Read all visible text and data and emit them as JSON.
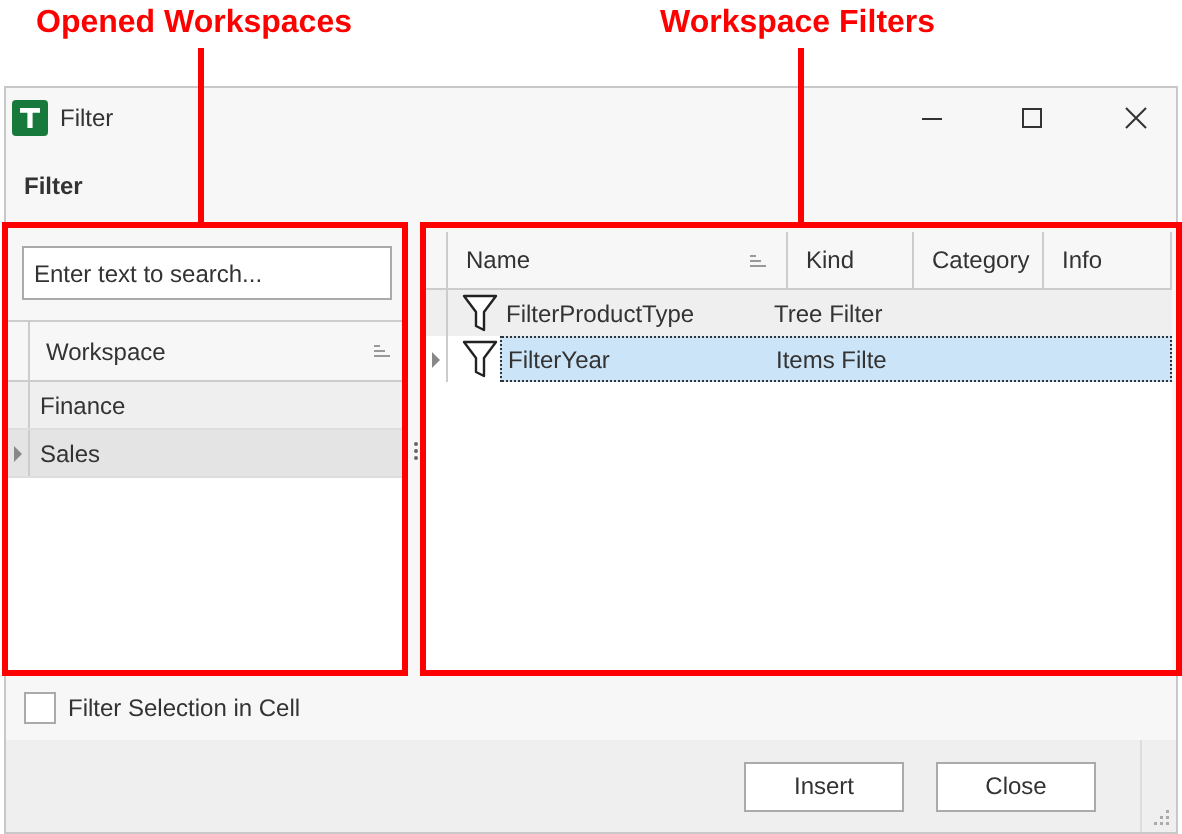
{
  "annotations": [
    {
      "label": "Opened Workspaces"
    },
    {
      "label": "Workspace Filters"
    }
  ],
  "window": {
    "title": "Filter"
  },
  "header": "Filter",
  "workspaces": {
    "search": {
      "placeholder": "Enter text to search..."
    },
    "column": "Workspace",
    "rows": [
      {
        "name": "Finance",
        "current": false
      },
      {
        "name": "Sales",
        "current": true
      }
    ]
  },
  "filters": {
    "columns": [
      "Name",
      "Kind",
      "Category",
      "Info"
    ],
    "rows": [
      {
        "name": "FilterProductType",
        "kind": "Tree Filter",
        "selected": false,
        "current": false
      },
      {
        "name": "FilterYear",
        "kind": "Items Filte",
        "selected": true,
        "current": true
      }
    ]
  },
  "option": {
    "label": "Filter Selection in Cell",
    "checked": false
  },
  "buttons": [
    "Insert",
    "Close"
  ]
}
